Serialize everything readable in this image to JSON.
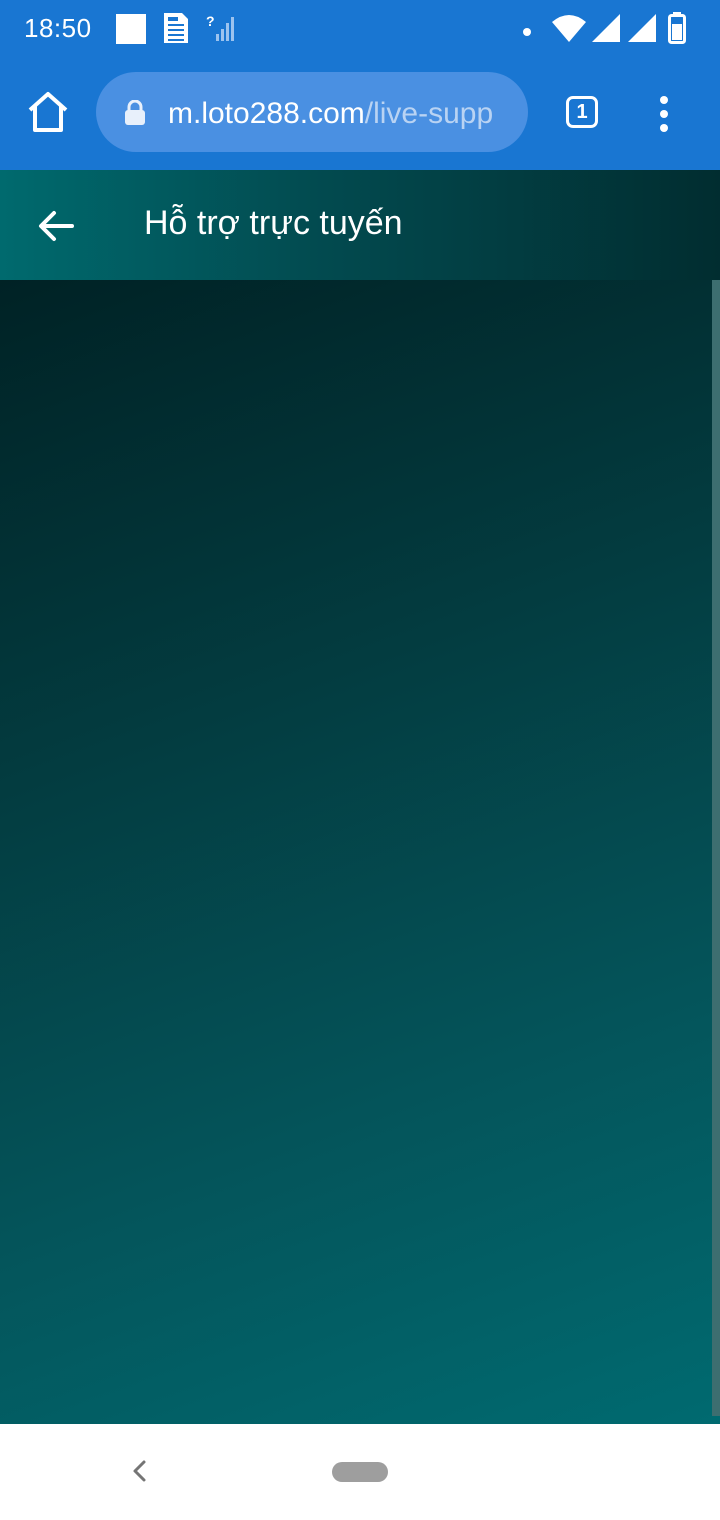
{
  "status_bar": {
    "time": "18:50",
    "icons_left": [
      "app-square-icon",
      "document-icon",
      "no-signal-icon"
    ],
    "icons_right": [
      "notification-dot-icon",
      "wifi-icon",
      "signal-icon",
      "signal-icon",
      "battery-icon"
    ]
  },
  "browser": {
    "url_domain": "m.loto288.com",
    "url_path": "/live-supp",
    "tab_count": "1",
    "icons": [
      "home-icon",
      "lock-icon",
      "tabs-icon",
      "more-vert-icon"
    ]
  },
  "header": {
    "title": "Hỗ trợ trực tuyến",
    "back_icon": "arrow-back-icon"
  },
  "nav": {
    "icons": [
      "chevron-left-icon",
      "home-pill-icon"
    ]
  },
  "colors": {
    "browser_blue": "#1976d2",
    "url_pill": "#4a90e2",
    "header_teal": "#006a6e",
    "content_dark": "#002225",
    "content_light": "#006a70"
  }
}
